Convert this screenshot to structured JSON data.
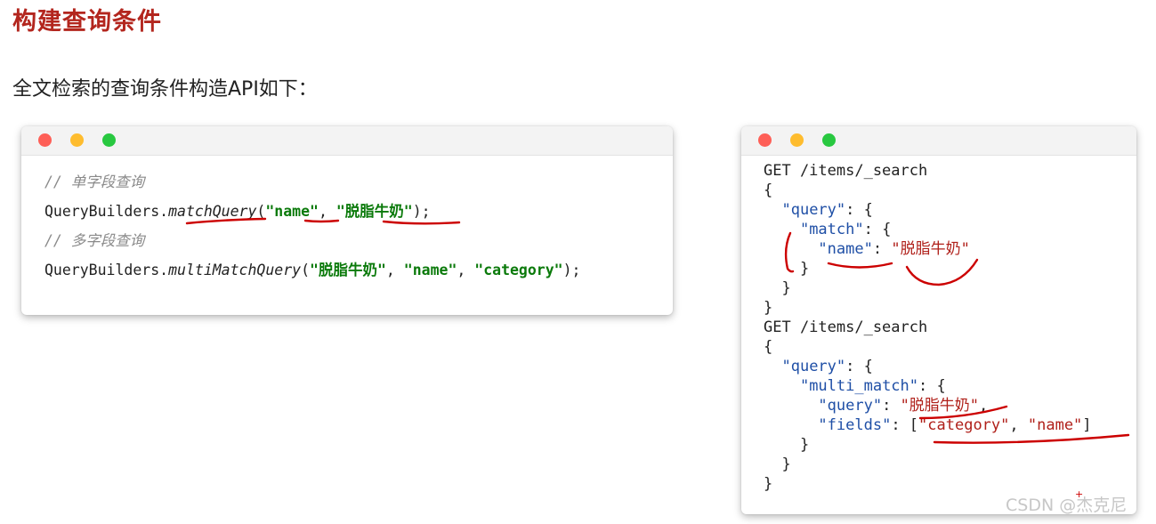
{
  "heading": "构建查询条件",
  "intro": "全文检索的查询条件构造API如下：",
  "java_panel": {
    "comment1": "// 单字段查询",
    "line1": {
      "prefix": "QueryBuilders.",
      "method": "matchQuery",
      "open": "(",
      "arg1": "\"name\"",
      "sep1": ", ",
      "arg2": "\"脱脂牛奶\"",
      "close": ");"
    },
    "comment2": "// 多字段查询",
    "line2": {
      "prefix": "QueryBuilders.",
      "method": "multiMatchQuery",
      "open": "(",
      "arg1": "\"脱脂牛奶\"",
      "sep1": ", ",
      "arg2": "\"name\"",
      "sep2": ", ",
      "arg3": "\"category\"",
      "close": ");"
    }
  },
  "dsl_panel": {
    "req1": {
      "l1": "GET /items/_search",
      "l2": "{",
      "l3_indent": "  ",
      "l3_key": "\"query\"",
      "l3_rest": ": {",
      "l4_indent": "    ",
      "l4_key": "\"match\"",
      "l4_rest": ": {",
      "l5_indent": "      ",
      "l5_key": "\"name\"",
      "l5_sep": ": ",
      "l5_val": "\"脱脂牛奶\"",
      "l6": "    }",
      "l7": "  }",
      "l8": "}"
    },
    "req2": {
      "l1": "GET /items/_search",
      "l2": "{",
      "l3_indent": "  ",
      "l3_key": "\"query\"",
      "l3_rest": ": {",
      "l4_indent": "    ",
      "l4_key": "\"multi_match\"",
      "l4_rest": ": {",
      "l5_indent": "      ",
      "l5_key": "\"query\"",
      "l5_sep": ": ",
      "l5_val": "\"脱脂牛奶\"",
      "l5_end": ",",
      "l6_indent": "      ",
      "l6_key": "\"fields\"",
      "l6_sep": ": [",
      "l6_v1": "\"category\"",
      "l6_sep2": ", ",
      "l6_v2": "\"name\"",
      "l6_end": "]",
      "l7": "    }",
      "l8": "  }",
      "l9": "}"
    }
  },
  "watermark": "CSDN @杰克尼",
  "colors": {
    "heading": "#b3261e",
    "annotation": "#cc0000",
    "string_green": "#0b7a0b",
    "json_key": "#1f4fa6",
    "json_string": "#b0201a"
  }
}
